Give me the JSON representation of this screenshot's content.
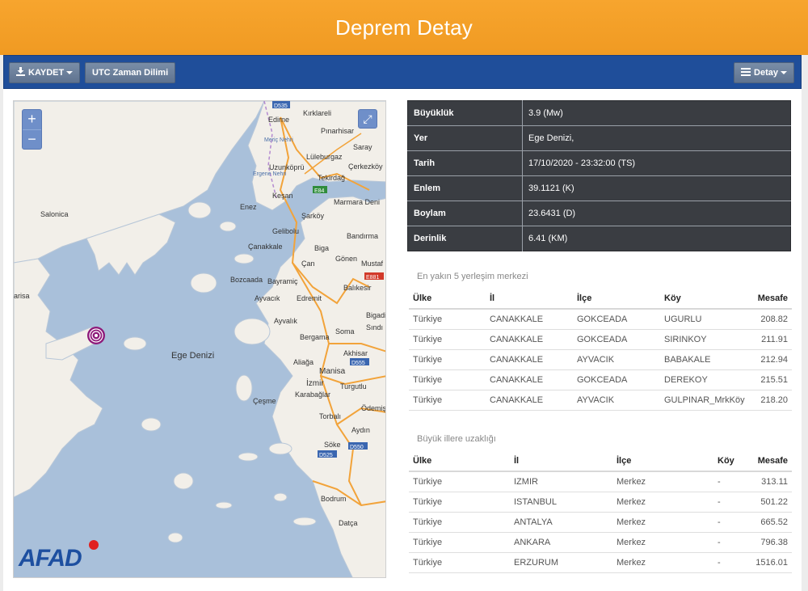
{
  "header": {
    "title": "Deprem Detay"
  },
  "toolbar": {
    "save_label": "KAYDET",
    "utc_label": "UTC Zaman Dilimi",
    "detail_label": "Detay"
  },
  "map": {
    "zoom_in": "+",
    "zoom_out": "−",
    "expand_symbol": "⤢",
    "logo_text": "AFAD",
    "labels": {
      "edirne": "Edirne",
      "kirklareli": "Kırklareli",
      "pinarhisar": "Pınarhisar",
      "saray": "Saray",
      "luleburgaz": "Lüleburgaz",
      "cerkezkoy": "Çerkezköy",
      "uzunkopru": "Uzunköprü",
      "tekirdag": "Tekirdağ",
      "kesan": "Keşan",
      "marmara": "Marmara Deni",
      "enez": "Enez",
      "sarkoy": "Şarköy",
      "gelibolu": "Gelibolu",
      "salonica": "Salonica",
      "canakkale": "Çanakkale",
      "biga": "Biga",
      "bandirma": "Bandırma",
      "can": "Çan",
      "gonen": "Gönen",
      "mustaf": "Mustaf",
      "bozcaada": "Bozcaada",
      "bayramic": "Bayramiç",
      "balikesir": "Balıkesir",
      "larisa": "arisa",
      "ayvacik": "Ayvacık",
      "edremit": "Edremit",
      "ayvalik": "Ayvalık",
      "bigadi": "Bigadi",
      "sindi": "Sındı",
      "bergama": "Bergama",
      "soma": "Soma",
      "ege": "Ege Denizi",
      "aliaga": "Aliağa",
      "akhisar": "Akhisar",
      "manisa": "Manisa",
      "izmir": "İzmir",
      "turgutlu": "Turgutlu",
      "karabaglar": "Karabağlar",
      "cesme": "Çeşme",
      "odemis": "Ödemiş",
      "torbali": "Torbalı",
      "aydin": "Aydın",
      "soke": "Söke",
      "bodrum": "Bodrum",
      "datca": "Datça",
      "e84": "E84",
      "e881": "E881",
      "d535": "D535",
      "d555": "D555",
      "d550": "D550",
      "d525": "D525",
      "maritsa": "Meriç Nehri",
      "ergene": "Ergene Nehri"
    }
  },
  "details": [
    {
      "key": "Büyüklük",
      "value": "3.9 (Mw)"
    },
    {
      "key": "Yer",
      "value": "Ege Denizi,"
    },
    {
      "key": "Tarih",
      "value": "17/10/2020 - 23:32:00 (TS)"
    },
    {
      "key": "Enlem",
      "value": "39.1121 (K)"
    },
    {
      "key": "Boylam",
      "value": "23.6431 (D)"
    },
    {
      "key": "Derinlik",
      "value": "6.41 (KM)"
    }
  ],
  "nearest": {
    "title": "En yakın 5 yerleşim merkezi",
    "headers": [
      "Ülke",
      "İl",
      "İlçe",
      "Köy",
      "Mesafe"
    ],
    "rows": [
      [
        "Türkiye",
        "CANAKKALE",
        "GOKCEADA",
        "UGURLU",
        "208.82"
      ],
      [
        "Türkiye",
        "CANAKKALE",
        "GOKCEADA",
        "SIRINKOY",
        "211.91"
      ],
      [
        "Türkiye",
        "CANAKKALE",
        "AYVACIK",
        "BABAKALE",
        "212.94"
      ],
      [
        "Türkiye",
        "CANAKKALE",
        "GOKCEADA",
        "DEREKOY",
        "215.51"
      ],
      [
        "Türkiye",
        "CANAKKALE",
        "AYVACIK",
        "GULPINAR_MrkKöy",
        "218.20"
      ]
    ]
  },
  "cities": {
    "title": "Büyük illere uzaklığı",
    "headers": [
      "Ülke",
      "İl",
      "İlçe",
      "Köy",
      "Mesafe"
    ],
    "rows": [
      [
        "Türkiye",
        "IZMIR",
        "Merkez",
        "-",
        "313.11"
      ],
      [
        "Türkiye",
        "ISTANBUL",
        "Merkez",
        "-",
        "501.22"
      ],
      [
        "Türkiye",
        "ANTALYA",
        "Merkez",
        "-",
        "665.52"
      ],
      [
        "Türkiye",
        "ANKARA",
        "Merkez",
        "-",
        "796.38"
      ],
      [
        "Türkiye",
        "ERZURUM",
        "Merkez",
        "-",
        "1516.01"
      ]
    ]
  },
  "colors": {
    "header": "#f6a02a",
    "toolbar": "#1f4e9a",
    "sea": "#a9c0da",
    "land": "#f2efe9",
    "epicenter": "#8e1a7a"
  }
}
